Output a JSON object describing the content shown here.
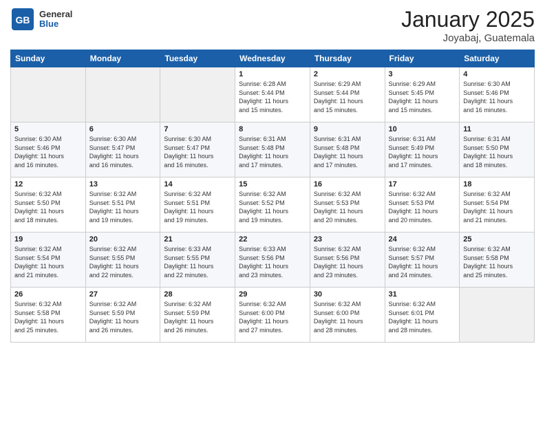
{
  "header": {
    "logo_general": "General",
    "logo_blue": "Blue",
    "month": "January 2025",
    "location": "Joyabaj, Guatemala"
  },
  "weekdays": [
    "Sunday",
    "Monday",
    "Tuesday",
    "Wednesday",
    "Thursday",
    "Friday",
    "Saturday"
  ],
  "weeks": [
    [
      {
        "day": "",
        "info": ""
      },
      {
        "day": "",
        "info": ""
      },
      {
        "day": "",
        "info": ""
      },
      {
        "day": "1",
        "info": "Sunrise: 6:28 AM\nSunset: 5:44 PM\nDaylight: 11 hours\nand 15 minutes."
      },
      {
        "day": "2",
        "info": "Sunrise: 6:29 AM\nSunset: 5:44 PM\nDaylight: 11 hours\nand 15 minutes."
      },
      {
        "day": "3",
        "info": "Sunrise: 6:29 AM\nSunset: 5:45 PM\nDaylight: 11 hours\nand 15 minutes."
      },
      {
        "day": "4",
        "info": "Sunrise: 6:30 AM\nSunset: 5:46 PM\nDaylight: 11 hours\nand 16 minutes."
      }
    ],
    [
      {
        "day": "5",
        "info": "Sunrise: 6:30 AM\nSunset: 5:46 PM\nDaylight: 11 hours\nand 16 minutes."
      },
      {
        "day": "6",
        "info": "Sunrise: 6:30 AM\nSunset: 5:47 PM\nDaylight: 11 hours\nand 16 minutes."
      },
      {
        "day": "7",
        "info": "Sunrise: 6:30 AM\nSunset: 5:47 PM\nDaylight: 11 hours\nand 16 minutes."
      },
      {
        "day": "8",
        "info": "Sunrise: 6:31 AM\nSunset: 5:48 PM\nDaylight: 11 hours\nand 17 minutes."
      },
      {
        "day": "9",
        "info": "Sunrise: 6:31 AM\nSunset: 5:48 PM\nDaylight: 11 hours\nand 17 minutes."
      },
      {
        "day": "10",
        "info": "Sunrise: 6:31 AM\nSunset: 5:49 PM\nDaylight: 11 hours\nand 17 minutes."
      },
      {
        "day": "11",
        "info": "Sunrise: 6:31 AM\nSunset: 5:50 PM\nDaylight: 11 hours\nand 18 minutes."
      }
    ],
    [
      {
        "day": "12",
        "info": "Sunrise: 6:32 AM\nSunset: 5:50 PM\nDaylight: 11 hours\nand 18 minutes."
      },
      {
        "day": "13",
        "info": "Sunrise: 6:32 AM\nSunset: 5:51 PM\nDaylight: 11 hours\nand 19 minutes."
      },
      {
        "day": "14",
        "info": "Sunrise: 6:32 AM\nSunset: 5:51 PM\nDaylight: 11 hours\nand 19 minutes."
      },
      {
        "day": "15",
        "info": "Sunrise: 6:32 AM\nSunset: 5:52 PM\nDaylight: 11 hours\nand 19 minutes."
      },
      {
        "day": "16",
        "info": "Sunrise: 6:32 AM\nSunset: 5:53 PM\nDaylight: 11 hours\nand 20 minutes."
      },
      {
        "day": "17",
        "info": "Sunrise: 6:32 AM\nSunset: 5:53 PM\nDaylight: 11 hours\nand 20 minutes."
      },
      {
        "day": "18",
        "info": "Sunrise: 6:32 AM\nSunset: 5:54 PM\nDaylight: 11 hours\nand 21 minutes."
      }
    ],
    [
      {
        "day": "19",
        "info": "Sunrise: 6:32 AM\nSunset: 5:54 PM\nDaylight: 11 hours\nand 21 minutes."
      },
      {
        "day": "20",
        "info": "Sunrise: 6:32 AM\nSunset: 5:55 PM\nDaylight: 11 hours\nand 22 minutes."
      },
      {
        "day": "21",
        "info": "Sunrise: 6:33 AM\nSunset: 5:55 PM\nDaylight: 11 hours\nand 22 minutes."
      },
      {
        "day": "22",
        "info": "Sunrise: 6:33 AM\nSunset: 5:56 PM\nDaylight: 11 hours\nand 23 minutes."
      },
      {
        "day": "23",
        "info": "Sunrise: 6:32 AM\nSunset: 5:56 PM\nDaylight: 11 hours\nand 23 minutes."
      },
      {
        "day": "24",
        "info": "Sunrise: 6:32 AM\nSunset: 5:57 PM\nDaylight: 11 hours\nand 24 minutes."
      },
      {
        "day": "25",
        "info": "Sunrise: 6:32 AM\nSunset: 5:58 PM\nDaylight: 11 hours\nand 25 minutes."
      }
    ],
    [
      {
        "day": "26",
        "info": "Sunrise: 6:32 AM\nSunset: 5:58 PM\nDaylight: 11 hours\nand 25 minutes."
      },
      {
        "day": "27",
        "info": "Sunrise: 6:32 AM\nSunset: 5:59 PM\nDaylight: 11 hours\nand 26 minutes."
      },
      {
        "day": "28",
        "info": "Sunrise: 6:32 AM\nSunset: 5:59 PM\nDaylight: 11 hours\nand 26 minutes."
      },
      {
        "day": "29",
        "info": "Sunrise: 6:32 AM\nSunset: 6:00 PM\nDaylight: 11 hours\nand 27 minutes."
      },
      {
        "day": "30",
        "info": "Sunrise: 6:32 AM\nSunset: 6:00 PM\nDaylight: 11 hours\nand 28 minutes."
      },
      {
        "day": "31",
        "info": "Sunrise: 6:32 AM\nSunset: 6:01 PM\nDaylight: 11 hours\nand 28 minutes."
      },
      {
        "day": "",
        "info": ""
      }
    ]
  ]
}
